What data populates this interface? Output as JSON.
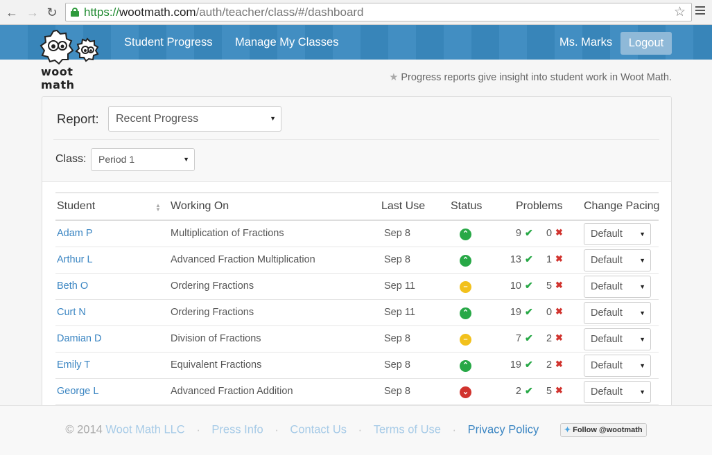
{
  "browser": {
    "url_scheme": "https://",
    "url_domain": "wootmath.com",
    "url_path": "/auth/teacher/class/#/dashboard"
  },
  "header": {
    "logo_text": "woot math",
    "nav": [
      "Student Progress",
      "Manage My Classes"
    ],
    "user_name": "Ms. Marks",
    "logout_label": "Logout"
  },
  "info_text": "Progress reports give insight into student work in Woot Math.",
  "report": {
    "label": "Report:",
    "selected": "Recent Progress"
  },
  "class_filter": {
    "label": "Class:",
    "selected": "Period 1"
  },
  "table": {
    "columns": [
      "Student",
      "Working On",
      "Last Use",
      "Status",
      "Problems",
      "Change Pacing"
    ],
    "rows": [
      {
        "student": "Adam P",
        "working_on": "Multiplication of Fractions",
        "last_use": "Sep 8",
        "status": "up",
        "correct": "9",
        "incorrect": "0",
        "pacing": "Default"
      },
      {
        "student": "Arthur L",
        "working_on": "Advanced Fraction Multiplication",
        "last_use": "Sep 8",
        "status": "up",
        "correct": "13",
        "incorrect": "1",
        "pacing": "Default"
      },
      {
        "student": "Beth O",
        "working_on": "Ordering Fractions",
        "last_use": "Sep 11",
        "status": "neutral",
        "correct": "10",
        "incorrect": "5",
        "pacing": "Default"
      },
      {
        "student": "Curt N",
        "working_on": "Ordering Fractions",
        "last_use": "Sep 11",
        "status": "up",
        "correct": "19",
        "incorrect": "0",
        "pacing": "Default"
      },
      {
        "student": "Damian D",
        "working_on": "Division of Fractions",
        "last_use": "Sep 8",
        "status": "neutral",
        "correct": "7",
        "incorrect": "2",
        "pacing": "Default"
      },
      {
        "student": "Emily T",
        "working_on": "Equivalent Fractions",
        "last_use": "Sep 8",
        "status": "up",
        "correct": "19",
        "incorrect": "2",
        "pacing": "Default"
      },
      {
        "student": "George L",
        "working_on": "Advanced Fraction Addition",
        "last_use": "Sep 8",
        "status": "down",
        "correct": "2",
        "incorrect": "5",
        "pacing": "Default"
      }
    ]
  },
  "status_colors": {
    "up": "#27a846",
    "neutral": "#f2c11c",
    "down": "#d1332e"
  },
  "footer": {
    "copyright": "© 2014",
    "company": "Woot Math LLC",
    "links": [
      "Press Info",
      "Contact Us",
      "Terms of Use",
      "Privacy Policy"
    ],
    "separator": "·",
    "twitter": "Follow @wootmath"
  }
}
